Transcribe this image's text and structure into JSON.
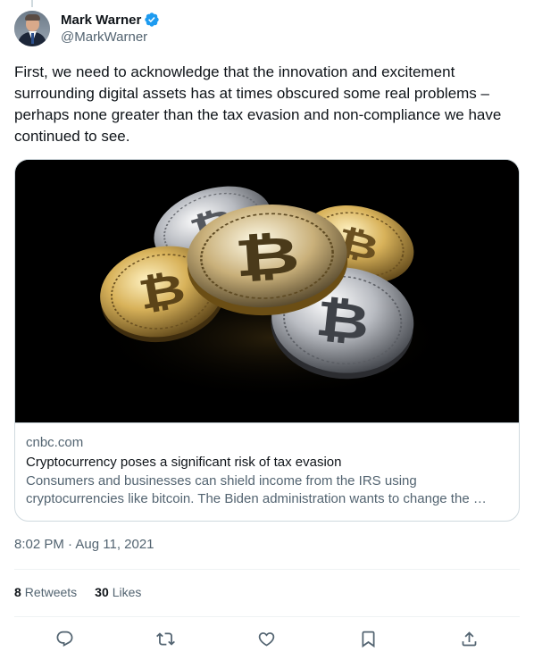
{
  "author": {
    "display_name": "Mark Warner",
    "handle": "@MarkWarner",
    "verified_icon": "verified-badge-icon",
    "verified_color": "#1d9bf0"
  },
  "tweet": {
    "text": "First, we need to acknowledge that the innovation and excitement surrounding digital assets has at times obscured some real problems – perhaps none greater than the tax evasion and non-compliance we have continued to see."
  },
  "card": {
    "image_icon": "bitcoin-coins-image",
    "domain": "cnbc.com",
    "title": "Cryptocurrency poses a significant risk of tax evasion",
    "description": "Consumers and businesses can shield income from the IRS using cryptocurrencies like bitcoin. The Biden administration wants to change the …"
  },
  "timestamp": {
    "time": "8:02 PM",
    "separator": "·",
    "date": "Aug 11, 2021"
  },
  "stats": {
    "retweets_count": "8",
    "retweets_label": "Retweets",
    "likes_count": "30",
    "likes_label": "Likes"
  },
  "actions": [
    "reply-icon",
    "retweet-icon",
    "like-icon",
    "bookmark-icon",
    "share-icon"
  ],
  "colors": {
    "text_primary": "#0f1419",
    "text_secondary": "#536471",
    "border": "#cfd9de",
    "accent": "#1d9bf0"
  }
}
